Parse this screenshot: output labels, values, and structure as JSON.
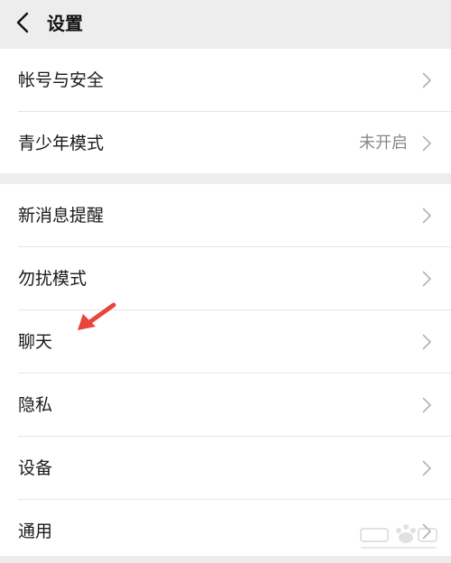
{
  "header": {
    "title": "设置",
    "back_icon": "chevron-left-icon"
  },
  "groups": [
    {
      "items": [
        {
          "label": "帐号与安全",
          "value": ""
        },
        {
          "label": "青少年模式",
          "value": "未开启"
        }
      ]
    },
    {
      "items": [
        {
          "label": "新消息提醒",
          "value": ""
        },
        {
          "label": "勿扰模式",
          "value": ""
        },
        {
          "label": "聊天",
          "value": ""
        },
        {
          "label": "隐私",
          "value": ""
        },
        {
          "label": "设备",
          "value": ""
        },
        {
          "label": "通用",
          "value": ""
        }
      ]
    }
  ],
  "colors": {
    "background": "#ededed",
    "row_background": "#ffffff",
    "text": "#1a1a1a",
    "secondary_text": "#888888",
    "chevron": "#b2b2b2",
    "annotation_arrow": "#e8453c"
  }
}
